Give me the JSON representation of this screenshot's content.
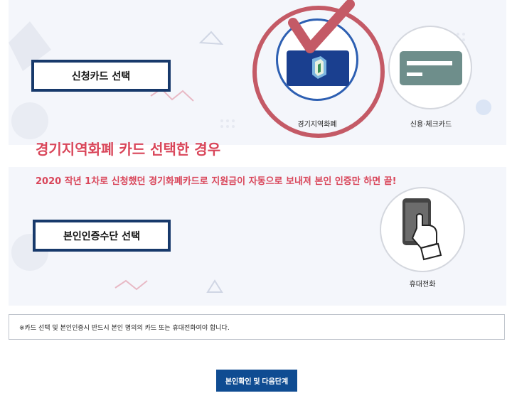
{
  "card_section": {
    "label": "신청카드 선택",
    "options": [
      {
        "label": "경기지역화폐",
        "icon": "gyeonggi-local-currency-card-icon",
        "selected": true
      },
      {
        "label": "신용·체크카드",
        "icon": "credit-card-icon",
        "selected": false
      }
    ]
  },
  "annotation": {
    "title": "경기지역화폐 카드 선택한 경우",
    "description": "2020 작년 1차로 신청했던 경기화폐카드로 지원금이 자동으로 보내져 본인 인증만 하면 끝!",
    "color": "#d9465a"
  },
  "auth_section": {
    "label": "본인인증수단 선택",
    "options": [
      {
        "label": "휴대전화",
        "icon": "mobile-phone-icon"
      }
    ]
  },
  "notice": {
    "text": "※카드 선택 및 본인인증시 반드시 본인 명의의 카드 또는 휴대전화여야 합니다."
  },
  "next_button": {
    "label": "본인확인 및 다음단계"
  },
  "colors": {
    "brand": "#17396b",
    "button": "#0f4c92",
    "panel_bg": "#f4f6fb",
    "selected_ring": "#2d5fb2"
  }
}
